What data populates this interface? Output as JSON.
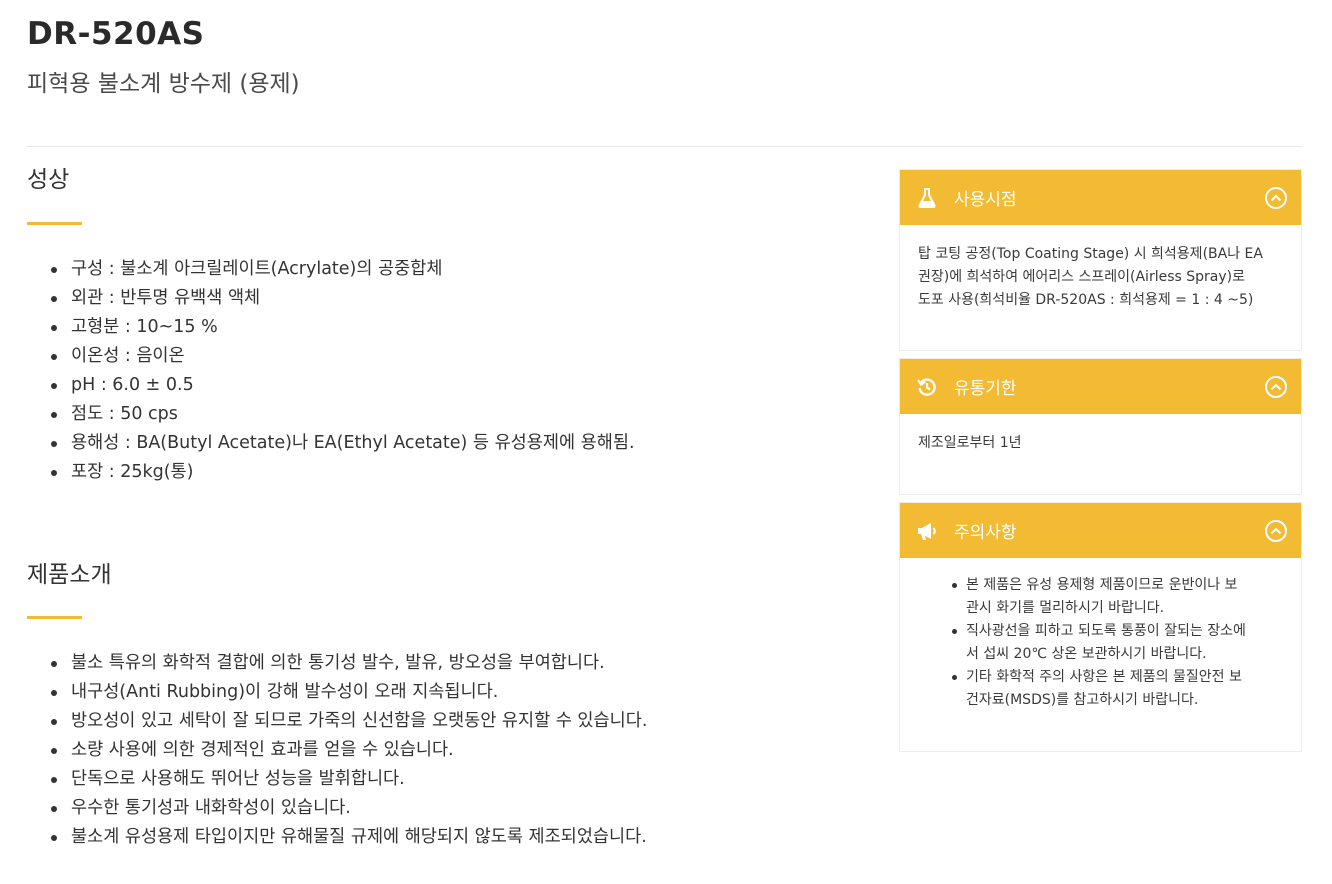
{
  "product": {
    "code": "DR-520AS",
    "subtitle": "피혁용 불소계 방수제 (용제)"
  },
  "properties": {
    "title": "성상",
    "items": [
      "구성 : 불소계 아크릴레이트(Acrylate)의 공중합체",
      "외관 : 반투명 유백색 액체",
      "고형분 : 10~15 %",
      "이온성 : 음이온",
      "pH : 6.0 ± 0.5",
      "점도 : 50 cps",
      "용해성 : BA(Butyl Acetate)나 EA(Ethyl Acetate) 등 유성용제에 용해됨.",
      "포장 : 25kg(통)"
    ]
  },
  "intro": {
    "title": "제품소개",
    "items": [
      " 불소 특유의 화학적 결합에 의한 통기성 발수, 발유, 방오성을 부여합니다.",
      "내구성(Anti Rubbing)이 강해 발수성이 오래 지속됩니다.",
      "방오성이 있고 세탁이 잘 되므로 가죽의 신선함을 오랫동안 유지할 수 있습니다.",
      "소량 사용에 의한 경제적인 효과를 얻을 수 있습니다.",
      "단독으로 사용해도 뛰어난 성능을 발휘합니다.",
      "우수한 통기성과 내화학성이 있습니다.",
      "불소계 유성용제 타입이지만 유해물질 규제에 해당되지 않도록 제조되었습니다."
    ]
  },
  "sidebar": {
    "accent_color": "#f2bb33",
    "panels": [
      {
        "title": "사용시점",
        "icon": "flask-icon",
        "lines": [
          "탑 코팅 공정(Top Coating Stage) 시 희석용제(BA나 EA",
          "권장)에 희석하여 에어리스 스프레이(Airless Spray)로",
          "도포 사용(희석비율 DR-520AS : 희석용제 = 1 : 4 ~5)"
        ]
      },
      {
        "title": "유통기한",
        "icon": "history-icon",
        "text": "제조일로부터 1년"
      },
      {
        "title": "주의사항",
        "icon": "megaphone-icon",
        "items": [
          [
            " 본 제품은 유성 용제형 제품이므로 운반이나 보",
            "관시 화기를 멀리하시기 바랍니다."
          ],
          [
            "직사광선을 피하고 되도록 통풍이 잘되는 장소에",
            "서 섭씨 20℃ 상온 보관하시기 바랍니다."
          ],
          [
            "기타 화학적 주의 사항은 본 제품의 물질안전 보",
            "건자료(MSDS)를 참고하시기 바랍니다."
          ]
        ]
      }
    ]
  }
}
